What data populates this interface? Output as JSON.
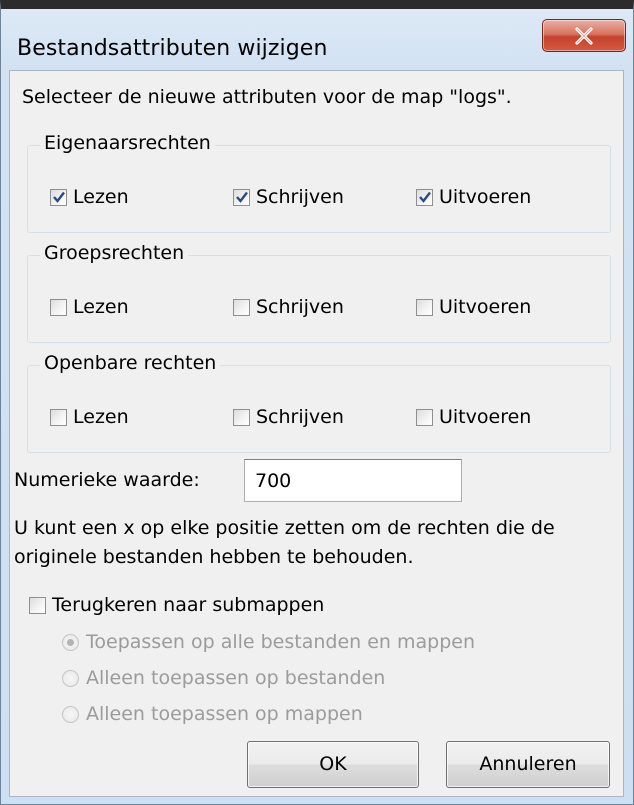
{
  "window": {
    "title": "Bestandsattributen wijzigen",
    "close_icon": "close-icon"
  },
  "intro_text": "Selecteer de nieuwe attributen voor de map \"logs\".",
  "groups": [
    {
      "label": "Eigenaarsrechten",
      "options": [
        {
          "label": "Lezen",
          "checked": true
        },
        {
          "label": "Schrijven",
          "checked": true
        },
        {
          "label": "Uitvoeren",
          "checked": true
        }
      ]
    },
    {
      "label": "Groepsrechten",
      "options": [
        {
          "label": "Lezen",
          "checked": false
        },
        {
          "label": "Schrijven",
          "checked": false
        },
        {
          "label": "Uitvoeren",
          "checked": false
        }
      ]
    },
    {
      "label": "Openbare rechten",
      "options": [
        {
          "label": "Lezen",
          "checked": false
        },
        {
          "label": "Schrijven",
          "checked": false
        },
        {
          "label": "Uitvoeren",
          "checked": false
        }
      ]
    }
  ],
  "numeric": {
    "label": "Numerieke waarde:",
    "value": "700"
  },
  "info_lines": [
    "U kunt een x op elke positie zetten om de rechten die de",
    "originele bestanden hebben te behouden."
  ],
  "recurse": {
    "label": "Terugkeren naar submappen",
    "checked": false
  },
  "radio_options": [
    {
      "label": "Toepassen op alle bestanden en mappen",
      "selected": true
    },
    {
      "label": "Alleen toepassen op bestanden",
      "selected": false
    },
    {
      "label": "Alleen toepassen op mappen",
      "selected": false
    }
  ],
  "buttons": {
    "ok": "OK",
    "cancel": "Annuleren"
  },
  "colors": {
    "disabled_text": "#9b9b9b",
    "close_button": "#c5412c"
  }
}
